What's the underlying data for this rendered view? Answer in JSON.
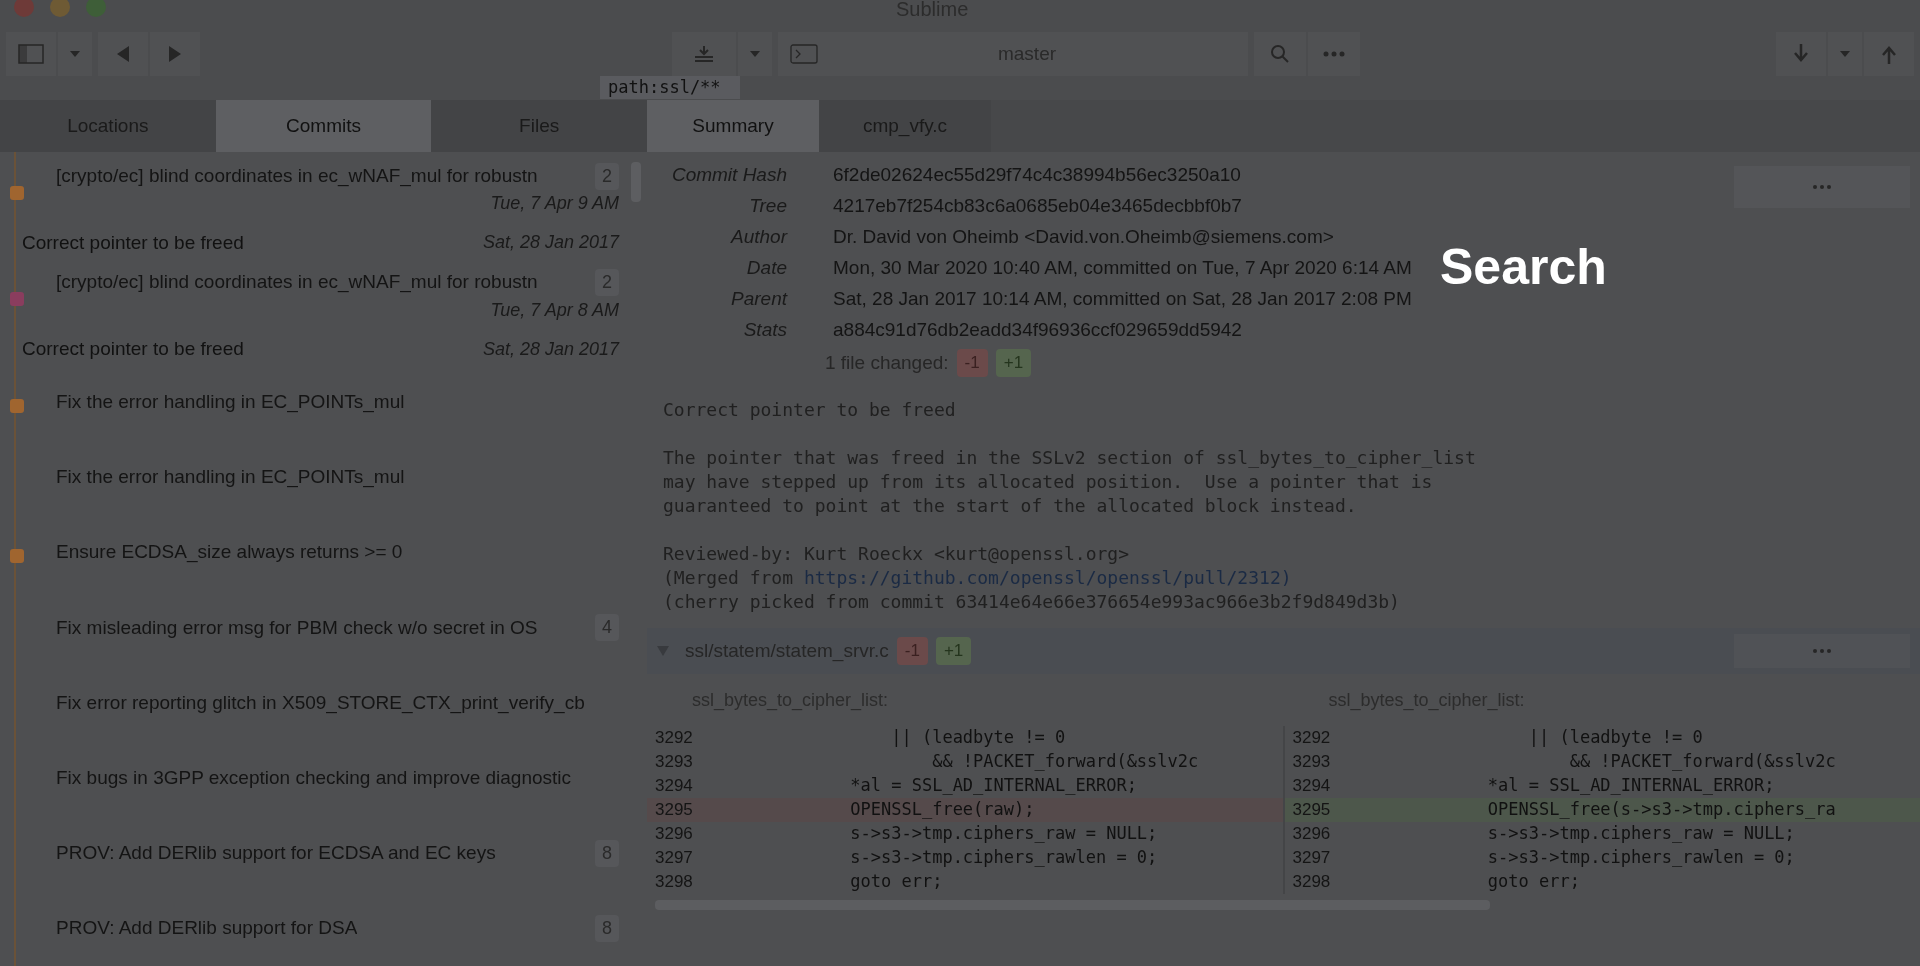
{
  "window": {
    "title": "Sublime"
  },
  "toolbar": {
    "branch": "master"
  },
  "left_tabs": [
    {
      "label": "Locations",
      "selected": false
    },
    {
      "label": "Commits",
      "selected": true
    },
    {
      "label": "Files",
      "selected": false
    }
  ],
  "search": {
    "value": "path:ssl/**"
  },
  "overlay_title": "Search",
  "commits": [
    {
      "kind": "commit",
      "title": "[crypto/ec] blind coordinates in ec_wNAF_mul for robustn",
      "count": "2",
      "date": "Tue, 7 Apr 9 AM",
      "color": "#a0652f"
    },
    {
      "kind": "ghost",
      "title": "Correct pointer to be freed",
      "date": "Sat, 28 Jan 2017"
    },
    {
      "kind": "commit",
      "title": "[crypto/ec] blind coordinates in ec_wNAF_mul for robustn",
      "count": "2",
      "date": "Tue, 7 Apr 8 AM",
      "color": "#8a3d5e"
    },
    {
      "kind": "ghost",
      "title": "Correct pointer to be freed",
      "date": "Sat, 28 Jan 2017"
    },
    {
      "kind": "commit",
      "title": "Fix the error handling in EC_POINTs_mul",
      "color": "#a0652f"
    },
    {
      "kind": "commit",
      "title": "Fix the error handling in EC_POINTs_mul"
    },
    {
      "kind": "commit",
      "title": "Ensure ECDSA_size always returns >= 0",
      "color": "#a0652f"
    },
    {
      "kind": "commit",
      "title": "Fix misleading error msg for PBM check w/o secret in OS",
      "count": "4"
    },
    {
      "kind": "commit",
      "title": "Fix error reporting glitch in X509_STORE_CTX_print_verify_cb"
    },
    {
      "kind": "commit",
      "title": "Fix bugs in 3GPP exception checking and improve diagnostic"
    },
    {
      "kind": "commit",
      "title": "PROV: Add DERlib support for ECDSA and EC keys",
      "count": "8"
    },
    {
      "kind": "commit",
      "title": "PROV: Add DERlib support for DSA",
      "count": "8"
    }
  ],
  "right_tabs": [
    {
      "label": "Summary",
      "selected": true
    },
    {
      "label": "cmp_vfy.c",
      "selected": false
    }
  ],
  "summary": [
    {
      "label": "Commit Hash",
      "value": "6f2de02624ec55d29f74c4c38994b56ec3250a10"
    },
    {
      "label": "Tree",
      "value": "4217eb7f254cb83c6a0685eb04e3465decbbf0b7"
    },
    {
      "label": "Author",
      "value": "Dr. David von Oheimb <David.von.Oheimb@siemens.com>"
    },
    {
      "label": "Date",
      "value": "Mon, 30 Mar 2020 10:40 AM, committed on Tue, 7 Apr 2020 6:14 AM"
    },
    {
      "label": "Parent",
      "value": "Sat, 28 Jan 2017 10:14 AM, committed on Sat, 28 Jan 2017 2:08 PM"
    },
    {
      "label": "Stats",
      "value": "a884c91d76db2eadd34f96936ccf029659dd5942"
    }
  ],
  "stats": {
    "label": "1 file changed:",
    "removed": "-1",
    "added": "+1"
  },
  "message": {
    "subject": "Correct pointer to be freed",
    "body": [
      "The pointer that was freed in the SSLv2 section of ssl_bytes_to_cipher_list",
      "may have stepped up from its allocated position.  Use a pointer that is",
      "guaranteed to point at the start of the allocated block instead."
    ],
    "reviewed": "Reviewed-by: Kurt Roeckx <kurt@openssl.org>",
    "merged_prefix": "(Merged from ",
    "merged_link": "https://github.com/openssl/openssl/pull/2312)",
    "cherry": "(cherry picked from commit 63414e64e66e376654e993ac966e3b2f9d849d3b)"
  },
  "diff": {
    "file": "ssl/statem/statem_srvr.c",
    "removed": "-1",
    "added": "+1",
    "expanded": true,
    "hunk_left": "ssl_bytes_to_cipher_list:",
    "hunk_right": "ssl_bytes_to_cipher_list:",
    "left": [
      {
        "num": "3292",
        "code": "                  || (leadbyte != 0"
      },
      {
        "num": "3293",
        "code": "                      && !PACKET_forward(&sslv2c"
      },
      {
        "num": "3294",
        "code": "              *al = SSL_AD_INTERNAL_ERROR;"
      },
      {
        "num": "3295",
        "code": "              OPENSSL_free(raw);",
        "kind": "removed"
      },
      {
        "num": "3296",
        "code": "              s->s3->tmp.ciphers_raw = NULL;"
      },
      {
        "num": "3297",
        "code": "              s->s3->tmp.ciphers_rawlen = 0;"
      },
      {
        "num": "3298",
        "code": "              goto err;"
      }
    ],
    "right": [
      {
        "num": "3292",
        "code": "                  || (leadbyte != 0"
      },
      {
        "num": "3293",
        "code": "                      && !PACKET_forward(&sslv2c"
      },
      {
        "num": "3294",
        "code": "              *al = SSL_AD_INTERNAL_ERROR;"
      },
      {
        "num": "3295",
        "code": "              OPENSSL_free(s->s3->tmp.ciphers_ra",
        "kind": "added"
      },
      {
        "num": "3296",
        "code": "              s->s3->tmp.ciphers_raw = NULL;"
      },
      {
        "num": "3297",
        "code": "              s->s3->tmp.ciphers_rawlen = 0;"
      },
      {
        "num": "3298",
        "code": "              goto err;"
      }
    ]
  }
}
